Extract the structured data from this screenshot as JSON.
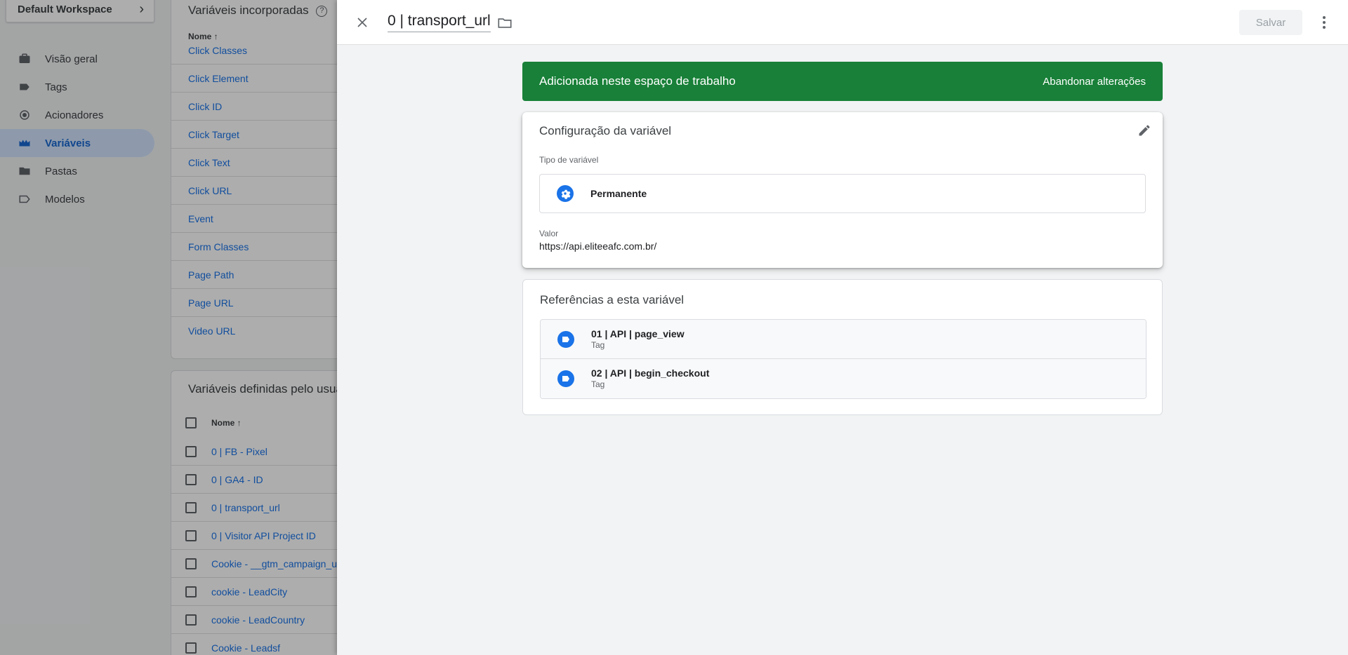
{
  "workspace": {
    "label": "Default Workspace"
  },
  "nav": {
    "items": [
      {
        "label": "Visão geral"
      },
      {
        "label": "Tags"
      },
      {
        "label": "Acionadores"
      },
      {
        "label": "Variáveis"
      },
      {
        "label": "Pastas"
      },
      {
        "label": "Modelos"
      }
    ]
  },
  "builtins": {
    "title": "Variáveis incorporadas",
    "col_name": "Nome",
    "rows": [
      "Click Classes",
      "Click Element",
      "Click ID",
      "Click Target",
      "Click Text",
      "Click URL",
      "Event",
      "Form Classes",
      "Page Path",
      "Page URL",
      "Video URL"
    ]
  },
  "user_vars": {
    "title": "Variáveis definidas pelo usuário",
    "col_name": "Nome",
    "rows": [
      "0 | FB - Pixel",
      "0 | GA4 - ID",
      "0 | transport_url",
      "0 | Visitor API Project ID",
      "Cookie - __gtm_campaign_url",
      "cookie - LeadCity",
      "cookie - LeadCountry",
      "Cookie - Leadsf"
    ]
  },
  "panel": {
    "title": "0 | transport_url",
    "save_label": "Salvar",
    "banner": {
      "text": "Adicionada neste espaço de trabalho",
      "action": "Abandonar alterações"
    },
    "config": {
      "title": "Configuração da variável",
      "type_label": "Tipo de variável",
      "type_name": "Permanente",
      "value_label": "Valor",
      "value": "https://api.eliteeafc.com.br/"
    },
    "refs": {
      "title": "Referências a esta variável",
      "items": [
        {
          "name": "01 | API | page_view",
          "type": "Tag"
        },
        {
          "name": "02 | API | begin_checkout",
          "type": "Tag"
        }
      ]
    }
  },
  "colors": {
    "accent": "#1a73e8",
    "banner": "#188038",
    "active_nav_bg": "#d2e3fc"
  }
}
